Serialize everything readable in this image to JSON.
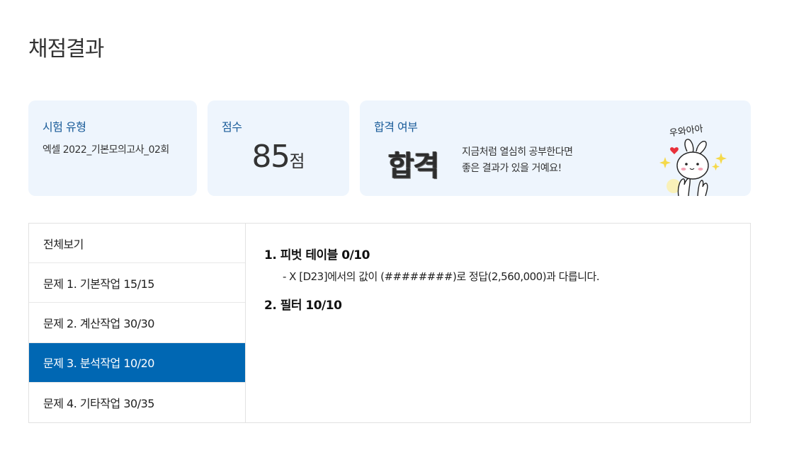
{
  "page": {
    "title": "채점결과"
  },
  "summary": {
    "exam_type": {
      "label": "시험 유형",
      "value": "엑셀 2022_기본모의고사_02회"
    },
    "score": {
      "label": "점수",
      "value": "85",
      "unit": "점"
    },
    "result": {
      "label": "합격 여부",
      "stamp": "합격",
      "message_line1": "지금처럼 열심히 공부한다면",
      "message_line2": "좋은 결과가 있을 거예요!",
      "mascot_text": "우와아아"
    }
  },
  "sidebar": {
    "items": [
      {
        "label": "전체보기"
      },
      {
        "label": "문제 1. 기본작업 15/15"
      },
      {
        "label": "문제 2. 계산작업 30/30"
      },
      {
        "label": "문제 3. 분석작업 10/20"
      },
      {
        "label": "문제 4. 기타작업 30/35"
      }
    ],
    "active_index": 3
  },
  "detail": {
    "questions": [
      {
        "title": "1. 피벗 테이블 0/10",
        "note": "- X [D23]에서의 값이 (########)로 정답(2,560,000)과 다릅니다."
      },
      {
        "title": "2. 필터 10/10"
      }
    ]
  },
  "colors": {
    "card_bg": "#eef5fd",
    "label_blue": "#1a5c99",
    "active_bg": "#0067b3"
  }
}
